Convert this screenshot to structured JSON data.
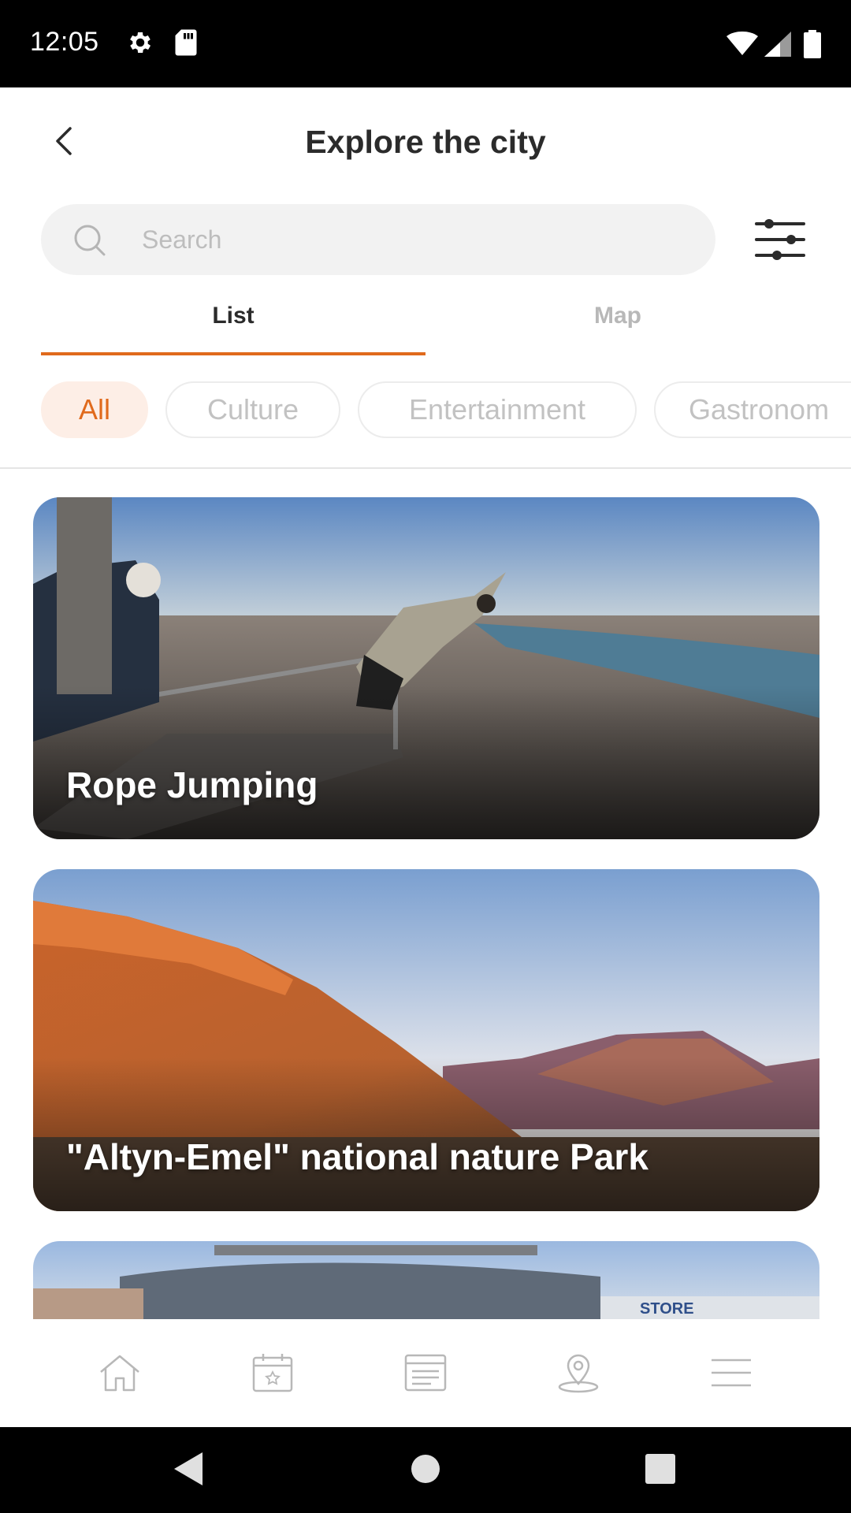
{
  "status_bar": {
    "time": "12:05"
  },
  "header": {
    "title": "Explore the city"
  },
  "search": {
    "placeholder": "Search"
  },
  "tabs": [
    {
      "label": "List",
      "active": true
    },
    {
      "label": "Map",
      "active": false
    }
  ],
  "chips": [
    {
      "label": "All",
      "active": true
    },
    {
      "label": "Culture",
      "active": false
    },
    {
      "label": "Entertainment",
      "active": false
    },
    {
      "label": "Gastronom",
      "active": false
    }
  ],
  "cards": [
    {
      "title": "Rope Jumping"
    },
    {
      "title": "\"Altyn-Emel\" national nature Park"
    },
    {
      "title": ""
    }
  ],
  "bottom_nav": [
    {
      "icon": "home-icon"
    },
    {
      "icon": "calendar-star-icon"
    },
    {
      "icon": "news-icon"
    },
    {
      "icon": "map-pin-icon"
    },
    {
      "icon": "menu-icon"
    }
  ],
  "colors": {
    "accent": "#e06a1c",
    "chip_active_bg": "#fdeee6",
    "inactive_text": "#c2c2c2"
  }
}
